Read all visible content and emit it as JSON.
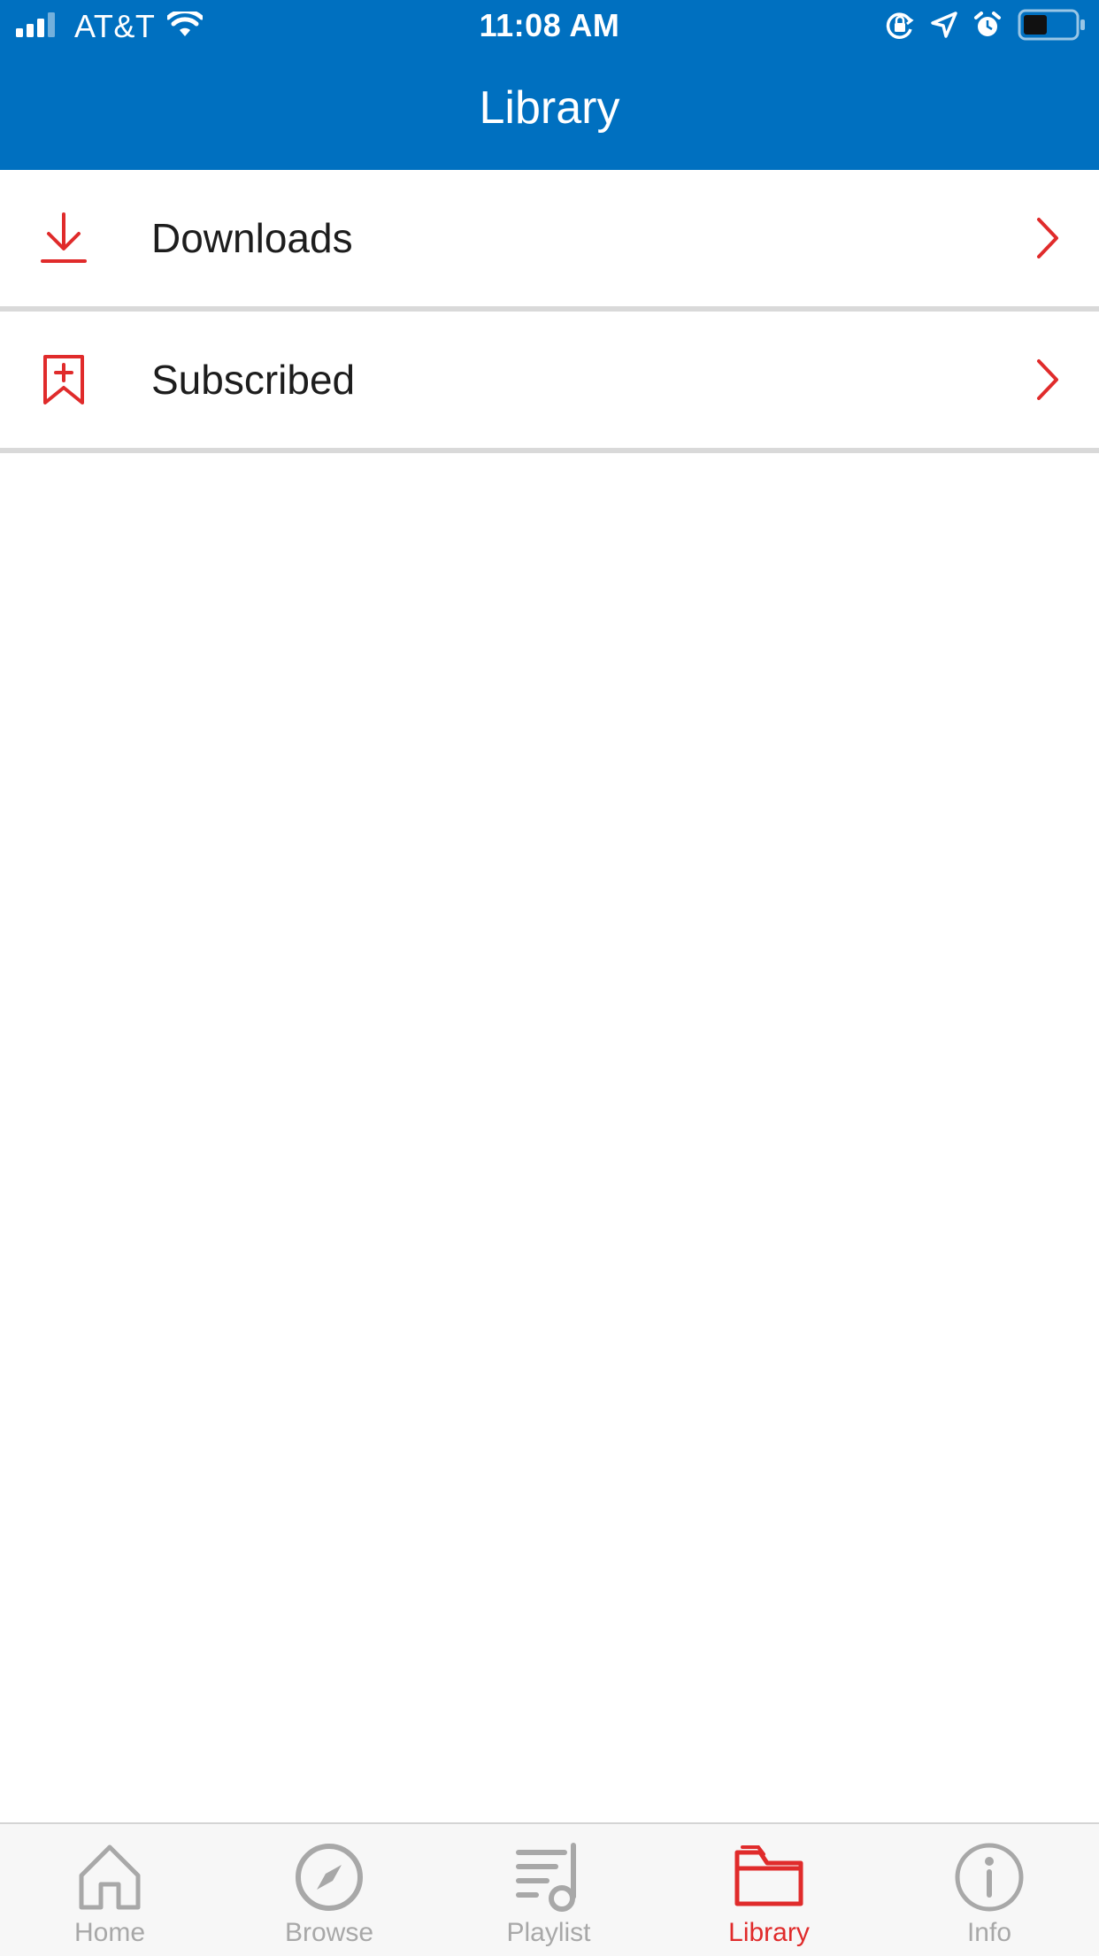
{
  "status_bar": {
    "carrier": "AT&T",
    "time": "11:08 AM",
    "icons": [
      "signal-icon",
      "wifi-icon",
      "rotation-lock-icon",
      "location-icon",
      "alarm-icon",
      "battery-icon"
    ]
  },
  "header": {
    "title": "Library",
    "background_color": "#0070C0"
  },
  "list": {
    "items": [
      {
        "label": "Downloads",
        "icon": "download-icon"
      },
      {
        "label": "Subscribed",
        "icon": "bookmark-plus-icon"
      }
    ],
    "accent_color": "#E02B2B"
  },
  "tabbar": {
    "tabs": [
      {
        "label": "Home",
        "icon": "home-icon",
        "active": false
      },
      {
        "label": "Browse",
        "icon": "compass-icon",
        "active": false
      },
      {
        "label": "Playlist",
        "icon": "playlist-icon",
        "active": false
      },
      {
        "label": "Library",
        "icon": "folder-icon",
        "active": true
      },
      {
        "label": "Info",
        "icon": "info-icon",
        "active": false
      }
    ],
    "active_color": "#E02B2B",
    "inactive_color": "#A8A8A8"
  }
}
